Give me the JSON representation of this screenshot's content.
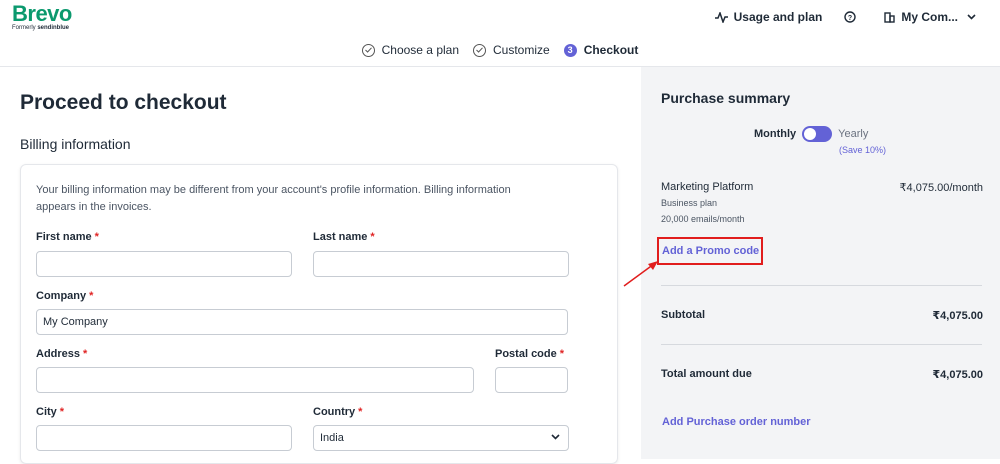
{
  "brand": {
    "name": "Brevo",
    "tagline_prefix": "Formerly",
    "tagline_name": "sendinblue",
    "color": "#0b996e"
  },
  "header": {
    "usage_label": "Usage and plan",
    "help_icon": "question-circle-icon",
    "account_label": "My Com..."
  },
  "steps": [
    {
      "label": "Choose a plan",
      "state": "done"
    },
    {
      "label": "Customize",
      "state": "done"
    },
    {
      "number": "3",
      "label": "Checkout",
      "state": "active"
    }
  ],
  "checkout": {
    "title": "Proceed to checkout",
    "section_title": "Billing information",
    "note": "Your billing information may be different from your account's profile information. Billing information appears in the invoices.",
    "required_mark": "*",
    "fields": {
      "first_name": {
        "label": "First name",
        "value": ""
      },
      "last_name": {
        "label": "Last name",
        "value": ""
      },
      "company": {
        "label": "Company",
        "value": "My Company"
      },
      "address": {
        "label": "Address",
        "value": ""
      },
      "postal_code": {
        "label": "Postal code",
        "value": ""
      },
      "city": {
        "label": "City",
        "value": ""
      },
      "country": {
        "label": "Country",
        "value": "India"
      }
    }
  },
  "summary": {
    "title": "Purchase summary",
    "billing_toggle": {
      "monthly": "Monthly",
      "yearly": "Yearly",
      "save_note": "(Save 10%)",
      "selected": "Monthly"
    },
    "product": {
      "name": "Marketing Platform",
      "price": "₹4,075.00/month",
      "plan": "Business plan",
      "volume": "20,000 emails/month"
    },
    "promo_link": "Add a Promo code",
    "subtotal_label": "Subtotal",
    "subtotal_value": "₹4,075.00",
    "total_label": "Total amount due",
    "total_value": "₹4,075.00",
    "po_link": "Add Purchase order number"
  },
  "colors": {
    "accent": "#6362d6",
    "highlight": "#e11d1d",
    "panel_bg": "#f3f4f6"
  }
}
